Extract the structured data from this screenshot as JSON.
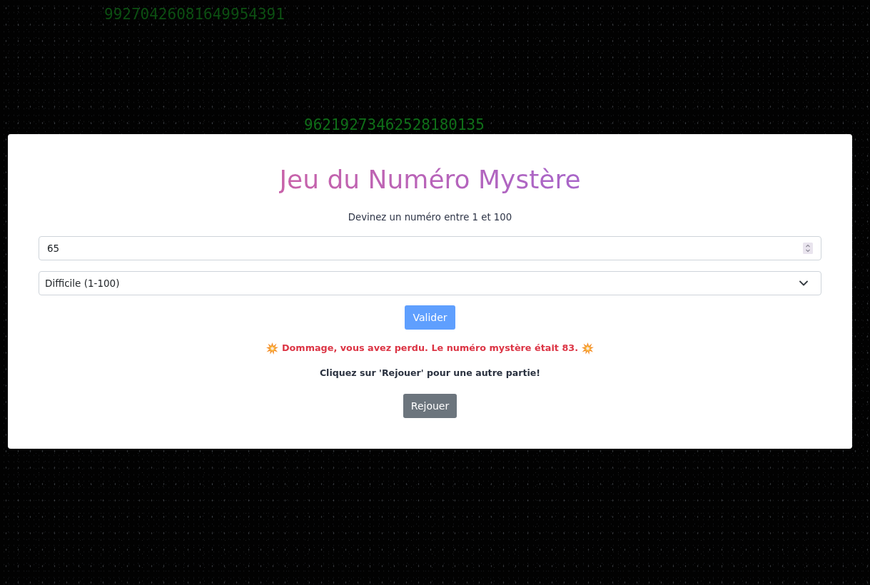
{
  "background_numbers": [
    {
      "text": "99270426081649954391",
      "color": "#0c4f12"
    },
    {
      "text": "96219273462528180135",
      "color": "#0f6e18"
    }
  ],
  "game": {
    "title": "Jeu du Numéro Mystère",
    "subtitle": "Devinez un numéro entre 1 et 100",
    "guess_input": {
      "value": "65"
    },
    "difficulty_select": {
      "value": "Difficile (1-100)"
    },
    "submit_button": {
      "label": "Valider",
      "disabled": true
    },
    "result_message": {
      "kind": "loss",
      "text": "Dommage, vous avez perdu. Le numéro mystère était 83."
    },
    "hint": "Cliquez sur 'Rejouer' pour une autre partie!",
    "replay_button": {
      "label": "Rejouer"
    }
  }
}
